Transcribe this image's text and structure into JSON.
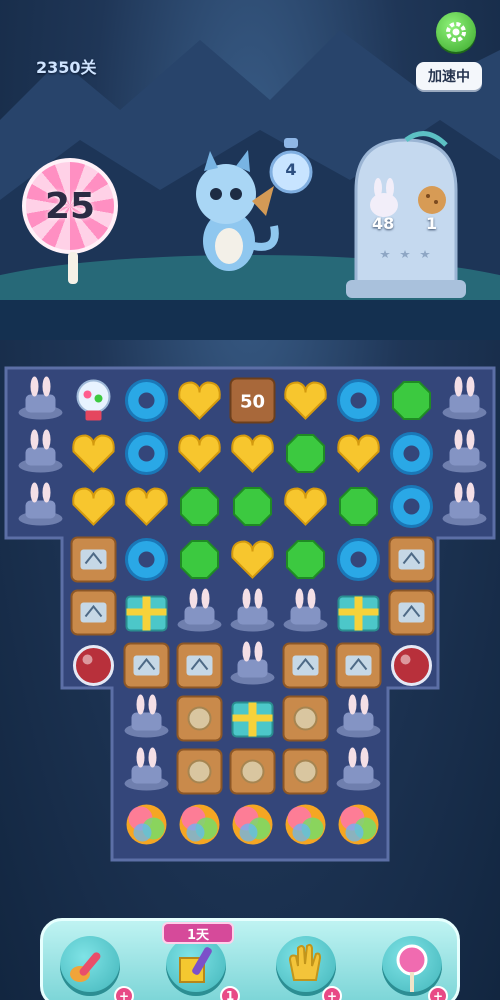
{
  "header": {
    "level_label": "2350关",
    "speed_label": "加速中"
  },
  "moves": {
    "remaining": "25"
  },
  "pot": {
    "count": "4"
  },
  "goals": [
    {
      "icon": "bunny-hat-icon",
      "count": "48"
    },
    {
      "icon": "cookie-icon",
      "count": "1"
    }
  ],
  "board": {
    "crate_counter": "50",
    "rows": [
      [
        "hat",
        "gumball-machine",
        "blue-donut",
        "yellow-heart",
        "crate-50",
        "yellow-heart",
        "blue-donut",
        "green-gem",
        "hat"
      ],
      [
        "hat",
        "yellow-heart",
        "blue-donut",
        "yellow-heart",
        "yellow-heart",
        "green-gem",
        "yellow-heart",
        "blue-donut",
        "hat"
      ],
      [
        "hat",
        "yellow-heart",
        "yellow-heart",
        "green-gem",
        "green-gem",
        "yellow-heart",
        "green-gem",
        "blue-donut",
        "hat"
      ],
      [
        "",
        "ticket-crate",
        "blue-donut",
        "green-gem",
        "yellow-heart",
        "green-gem",
        "blue-donut",
        "ticket-crate",
        ""
      ],
      [
        "",
        "ticket-crate",
        "gift-box",
        "hat",
        "hat",
        "hat",
        "gift-box",
        "ticket-crate",
        ""
      ],
      [
        "",
        "potion",
        "ticket-crate",
        "ticket-crate",
        "hat",
        "ticket-crate",
        "ticket-crate",
        "potion",
        ""
      ],
      [
        "",
        "",
        "hat",
        "plain-crate",
        "gift-box",
        "plain-crate",
        "hat",
        "",
        ""
      ],
      [
        "",
        "",
        "hat",
        "plain-crate",
        "plain-crate",
        "plain-crate",
        "hat",
        "",
        ""
      ],
      [
        "",
        "",
        "rainbow-ball",
        "rainbow-ball",
        "rainbow-ball",
        "rainbow-ball",
        "rainbow-ball",
        "",
        ""
      ]
    ]
  },
  "boosters": [
    {
      "name": "spoon",
      "badge": "+"
    },
    {
      "name": "cube-hammer",
      "badge": "1",
      "tag": "1天"
    },
    {
      "name": "glove",
      "badge": "+"
    },
    {
      "name": "lollipop",
      "badge": "+"
    }
  ],
  "colors": {
    "board_bg": "#2e3d6e",
    "accent_pink": "#e84a86",
    "bar_teal": "#79d4d6"
  }
}
